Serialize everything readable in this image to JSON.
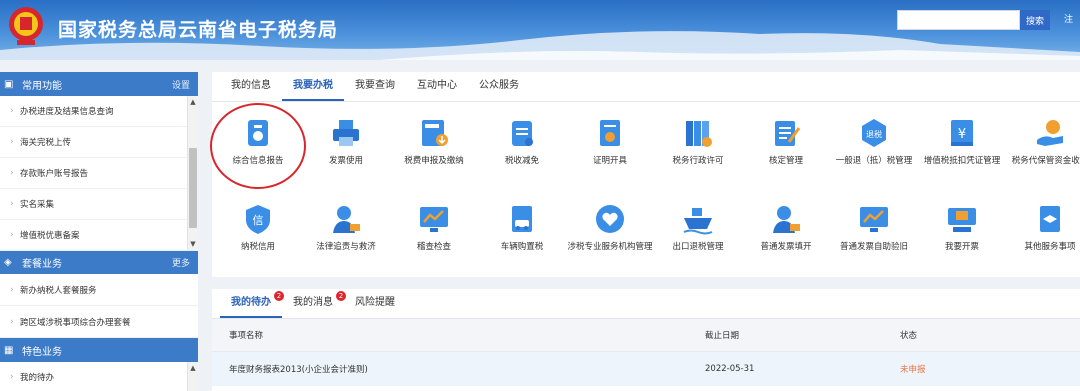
{
  "header": {
    "site_title": "国家税务总局云南省电子税务局",
    "emblem_text": "中国税务",
    "search_placeholder": "",
    "search_button": "搜索",
    "extra_label": "注"
  },
  "sidebar": {
    "sections": [
      {
        "title": "常用功能",
        "link": "设置",
        "icon": "home-icon"
      },
      {
        "title": "套餐业务",
        "link": "更多",
        "icon": "layers-icon"
      },
      {
        "title": "特色业务",
        "link": "",
        "icon": "grid-icon"
      }
    ],
    "common_items": [
      "办税进度及结果信息查询",
      "海关完税上传",
      "存款账户账号报告",
      "实名采集",
      "增值税优惠备案"
    ],
    "package_items": [
      "新办纳税人套餐服务",
      "跨区域涉税事项综合办理套餐"
    ],
    "feature_items": [
      "我的待办"
    ]
  },
  "main_tabs": [
    "我的信息",
    "我要办税",
    "我要查询",
    "互动中心",
    "公众服务"
  ],
  "services_row1": [
    {
      "label": "综合信息报告",
      "icon": "info-report-icon"
    },
    {
      "label": "发票使用",
      "icon": "printer-icon"
    },
    {
      "label": "税费申报及缴纳",
      "icon": "tax-declare-icon"
    },
    {
      "label": "税收减免",
      "icon": "tax-relief-icon"
    },
    {
      "label": "证明开具",
      "icon": "certificate-icon"
    },
    {
      "label": "税务行政许可",
      "icon": "binders-icon"
    },
    {
      "label": "核定管理",
      "icon": "approval-icon"
    },
    {
      "label": "一般退（抵）税管理",
      "icon": "refund-icon"
    },
    {
      "label": "增值税抵扣凭证管理",
      "icon": "vat-voucher-icon"
    },
    {
      "label": "税务代保管资金收取",
      "icon": "fund-custody-icon"
    }
  ],
  "services_row2": [
    {
      "label": "纳税信用",
      "icon": "credit-icon"
    },
    {
      "label": "法律追责与救济",
      "icon": "legal-icon"
    },
    {
      "label": "稽查检查",
      "icon": "inspection-icon"
    },
    {
      "label": "车辆购置税",
      "icon": "vehicle-tax-icon"
    },
    {
      "label": "涉税专业服务机构管理",
      "icon": "agency-icon"
    },
    {
      "label": "出口退税管理",
      "icon": "export-ship-icon"
    },
    {
      "label": "普通发票填开",
      "icon": "invoice-issue-icon"
    },
    {
      "label": "普通发票自助验旧",
      "icon": "invoice-verify-icon"
    },
    {
      "label": "我要开票",
      "icon": "issue-invoice-icon"
    },
    {
      "label": "其他服务事项",
      "icon": "other-services-icon"
    }
  ],
  "todo": {
    "tabs": [
      {
        "label": "我的待办",
        "badge": "2"
      },
      {
        "label": "我的消息",
        "badge": "2"
      },
      {
        "label": "风险提醒",
        "badge": ""
      }
    ],
    "columns": [
      "事项名称",
      "截止日期",
      "状态"
    ],
    "rows": [
      {
        "name": "年度财务报表2013(小企业会计准则)",
        "deadline": "2022-05-31",
        "status": "未申报"
      }
    ]
  },
  "colors": {
    "accent": "#2a63b8",
    "header_blue": "#3c7bc8",
    "highlight_circle": "#d9262c",
    "status_pending": "#e8764a"
  }
}
